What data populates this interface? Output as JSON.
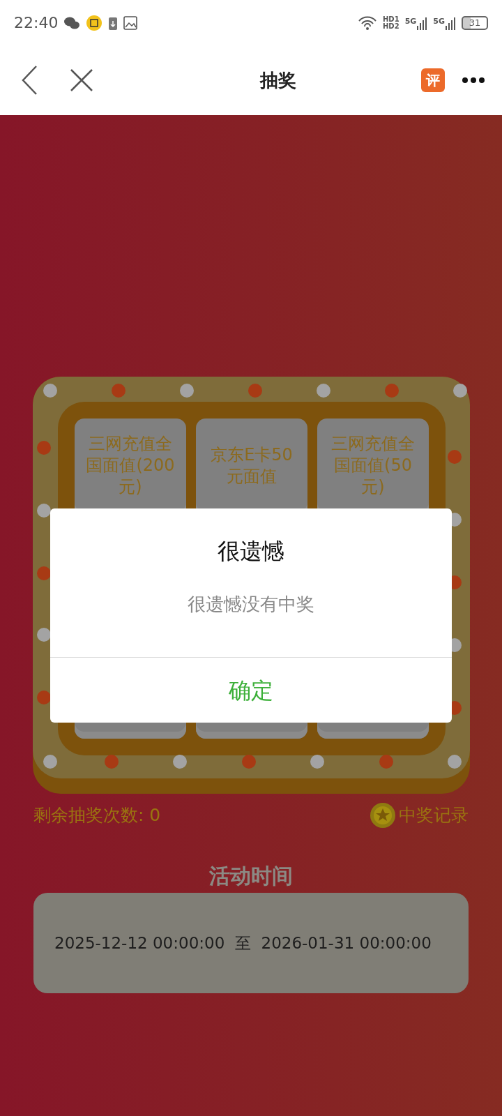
{
  "status_bar": {
    "time": "22:40",
    "hd_labels": [
      "HD1",
      "HD2"
    ],
    "network_labels": [
      "5G",
      "5G"
    ],
    "battery": "31"
  },
  "header": {
    "title": "抽奖",
    "review_badge": "评"
  },
  "lottery": {
    "top_prizes": [
      {
        "label": "三网充值全国面值(200元)"
      },
      {
        "label": "京东E卡50元面值"
      },
      {
        "label": "三网充值全国面值(50元)"
      }
    ]
  },
  "remaining": "剩余抽奖次数: 0",
  "records_link": "中奖记录",
  "activity": {
    "title": "活动时间",
    "period": "2025-12-12 00:00:00  至  2026-01-31 00:00:00"
  },
  "dialog": {
    "title": "很遗憾",
    "message": "很遗憾没有中奖",
    "confirm": "确定"
  }
}
